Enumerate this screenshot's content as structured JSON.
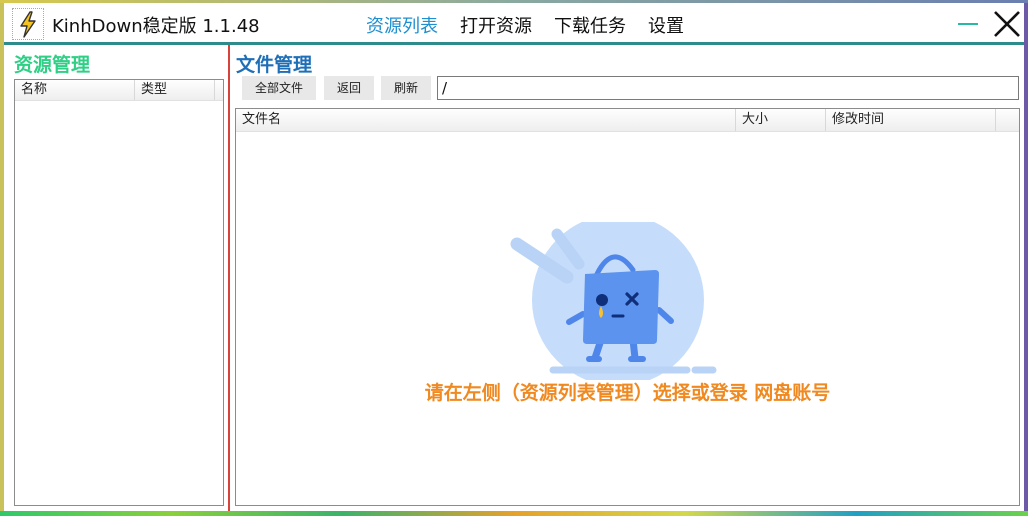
{
  "app": {
    "title": "KinhDown稳定版 1.1.48"
  },
  "nav": {
    "items": [
      {
        "label": "资源列表",
        "active": true
      },
      {
        "label": "打开资源",
        "active": false
      },
      {
        "label": "下载任务",
        "active": false
      },
      {
        "label": "设置",
        "active": false
      }
    ]
  },
  "left_panel": {
    "title": "资源管理",
    "columns": [
      "名称",
      "类型"
    ]
  },
  "right_panel": {
    "title": "文件管理",
    "buttons": {
      "all_files": "全部文件",
      "back": "返回",
      "refresh": "刷新"
    },
    "path_value": "/",
    "columns": [
      "文件名",
      "大小",
      "修改时间"
    ],
    "empty_message": "请在左侧（资源列表管理）选择或登录 网盘账号"
  },
  "colors": {
    "accent_nav": "#1e8fd0",
    "left_title": "#2fcf86",
    "right_title": "#1e6fb8",
    "divider": "#d9423a",
    "empty_message": "#f0891f",
    "titlebar_line": "#2e8b8b"
  },
  "icons": {
    "logo": "lightning-bolt-icon",
    "minimize": "minimize-icon",
    "close": "close-icon",
    "empty_state": "empty-bag-illustration"
  }
}
